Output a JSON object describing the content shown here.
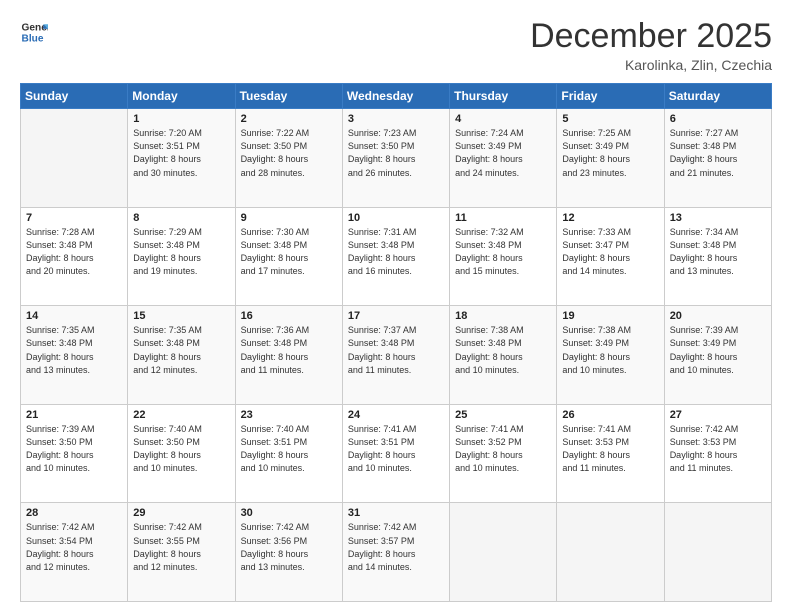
{
  "logo": {
    "line1": "General",
    "line2": "Blue"
  },
  "header": {
    "month": "December 2025",
    "location": "Karolinka, Zlin, Czechia"
  },
  "days_of_week": [
    "Sunday",
    "Monday",
    "Tuesday",
    "Wednesday",
    "Thursday",
    "Friday",
    "Saturday"
  ],
  "weeks": [
    [
      {
        "day": "",
        "info": ""
      },
      {
        "day": "1",
        "info": "Sunrise: 7:20 AM\nSunset: 3:51 PM\nDaylight: 8 hours\nand 30 minutes."
      },
      {
        "day": "2",
        "info": "Sunrise: 7:22 AM\nSunset: 3:50 PM\nDaylight: 8 hours\nand 28 minutes."
      },
      {
        "day": "3",
        "info": "Sunrise: 7:23 AM\nSunset: 3:50 PM\nDaylight: 8 hours\nand 26 minutes."
      },
      {
        "day": "4",
        "info": "Sunrise: 7:24 AM\nSunset: 3:49 PM\nDaylight: 8 hours\nand 24 minutes."
      },
      {
        "day": "5",
        "info": "Sunrise: 7:25 AM\nSunset: 3:49 PM\nDaylight: 8 hours\nand 23 minutes."
      },
      {
        "day": "6",
        "info": "Sunrise: 7:27 AM\nSunset: 3:48 PM\nDaylight: 8 hours\nand 21 minutes."
      }
    ],
    [
      {
        "day": "7",
        "info": "Sunrise: 7:28 AM\nSunset: 3:48 PM\nDaylight: 8 hours\nand 20 minutes."
      },
      {
        "day": "8",
        "info": "Sunrise: 7:29 AM\nSunset: 3:48 PM\nDaylight: 8 hours\nand 19 minutes."
      },
      {
        "day": "9",
        "info": "Sunrise: 7:30 AM\nSunset: 3:48 PM\nDaylight: 8 hours\nand 17 minutes."
      },
      {
        "day": "10",
        "info": "Sunrise: 7:31 AM\nSunset: 3:48 PM\nDaylight: 8 hours\nand 16 minutes."
      },
      {
        "day": "11",
        "info": "Sunrise: 7:32 AM\nSunset: 3:48 PM\nDaylight: 8 hours\nand 15 minutes."
      },
      {
        "day": "12",
        "info": "Sunrise: 7:33 AM\nSunset: 3:47 PM\nDaylight: 8 hours\nand 14 minutes."
      },
      {
        "day": "13",
        "info": "Sunrise: 7:34 AM\nSunset: 3:48 PM\nDaylight: 8 hours\nand 13 minutes."
      }
    ],
    [
      {
        "day": "14",
        "info": "Sunrise: 7:35 AM\nSunset: 3:48 PM\nDaylight: 8 hours\nand 13 minutes."
      },
      {
        "day": "15",
        "info": "Sunrise: 7:35 AM\nSunset: 3:48 PM\nDaylight: 8 hours\nand 12 minutes."
      },
      {
        "day": "16",
        "info": "Sunrise: 7:36 AM\nSunset: 3:48 PM\nDaylight: 8 hours\nand 11 minutes."
      },
      {
        "day": "17",
        "info": "Sunrise: 7:37 AM\nSunset: 3:48 PM\nDaylight: 8 hours\nand 11 minutes."
      },
      {
        "day": "18",
        "info": "Sunrise: 7:38 AM\nSunset: 3:48 PM\nDaylight: 8 hours\nand 10 minutes."
      },
      {
        "day": "19",
        "info": "Sunrise: 7:38 AM\nSunset: 3:49 PM\nDaylight: 8 hours\nand 10 minutes."
      },
      {
        "day": "20",
        "info": "Sunrise: 7:39 AM\nSunset: 3:49 PM\nDaylight: 8 hours\nand 10 minutes."
      }
    ],
    [
      {
        "day": "21",
        "info": "Sunrise: 7:39 AM\nSunset: 3:50 PM\nDaylight: 8 hours\nand 10 minutes."
      },
      {
        "day": "22",
        "info": "Sunrise: 7:40 AM\nSunset: 3:50 PM\nDaylight: 8 hours\nand 10 minutes."
      },
      {
        "day": "23",
        "info": "Sunrise: 7:40 AM\nSunset: 3:51 PM\nDaylight: 8 hours\nand 10 minutes."
      },
      {
        "day": "24",
        "info": "Sunrise: 7:41 AM\nSunset: 3:51 PM\nDaylight: 8 hours\nand 10 minutes."
      },
      {
        "day": "25",
        "info": "Sunrise: 7:41 AM\nSunset: 3:52 PM\nDaylight: 8 hours\nand 10 minutes."
      },
      {
        "day": "26",
        "info": "Sunrise: 7:41 AM\nSunset: 3:53 PM\nDaylight: 8 hours\nand 11 minutes."
      },
      {
        "day": "27",
        "info": "Sunrise: 7:42 AM\nSunset: 3:53 PM\nDaylight: 8 hours\nand 11 minutes."
      }
    ],
    [
      {
        "day": "28",
        "info": "Sunrise: 7:42 AM\nSunset: 3:54 PM\nDaylight: 8 hours\nand 12 minutes."
      },
      {
        "day": "29",
        "info": "Sunrise: 7:42 AM\nSunset: 3:55 PM\nDaylight: 8 hours\nand 12 minutes."
      },
      {
        "day": "30",
        "info": "Sunrise: 7:42 AM\nSunset: 3:56 PM\nDaylight: 8 hours\nand 13 minutes."
      },
      {
        "day": "31",
        "info": "Sunrise: 7:42 AM\nSunset: 3:57 PM\nDaylight: 8 hours\nand 14 minutes."
      },
      {
        "day": "",
        "info": ""
      },
      {
        "day": "",
        "info": ""
      },
      {
        "day": "",
        "info": ""
      }
    ]
  ]
}
